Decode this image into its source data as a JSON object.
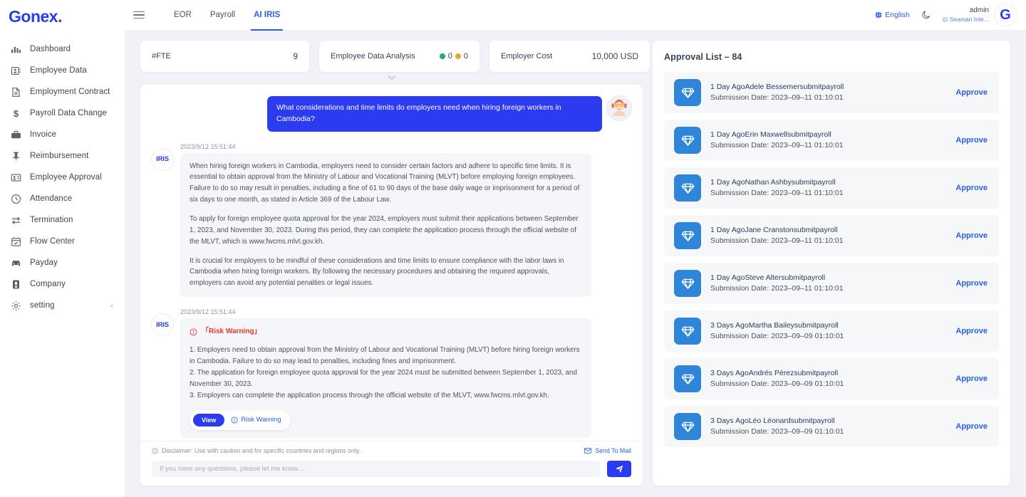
{
  "brand": {
    "logo": "Gonex."
  },
  "sidebar": {
    "items": [
      {
        "label": "Dashboard",
        "icon": "bar-chart-icon"
      },
      {
        "label": "Employee Data",
        "icon": "id-card-icon"
      },
      {
        "label": "Employment Contract",
        "icon": "document-icon"
      },
      {
        "label": "Payroll Data Change",
        "icon": "dollar-icon"
      },
      {
        "label": "Invoice",
        "icon": "briefcase-icon"
      },
      {
        "label": "Reimbursement",
        "icon": "pin-icon"
      },
      {
        "label": "Employee Approval",
        "icon": "badge-icon"
      },
      {
        "label": "Attendance",
        "icon": "clock-icon"
      },
      {
        "label": "Termination",
        "icon": "transfer-icon"
      },
      {
        "label": "Flow Center",
        "icon": "calendar-check-icon"
      },
      {
        "label": "Payday",
        "icon": "car-icon"
      },
      {
        "label": "Company",
        "icon": "building-icon"
      },
      {
        "label": "setting",
        "icon": "gear-icon",
        "chevron": "‹"
      }
    ]
  },
  "topbar": {
    "tabs": [
      {
        "label": "EOR",
        "active": false
      },
      {
        "label": "Payroll",
        "active": false
      },
      {
        "label": "AI IRIS",
        "active": true
      }
    ],
    "language": "English",
    "user_name": "admin",
    "user_org": "Seaman Inte...",
    "avatar_letter": "G"
  },
  "metrics": {
    "fte": {
      "label": "#FTE",
      "value": "9"
    },
    "employee_data_analysis": {
      "label": "Employee Data Analysis",
      "green_count": "0",
      "amber_count": "0"
    },
    "employer_cost": {
      "label": "Employer Cost",
      "value": "10,000 USD"
    }
  },
  "chat": {
    "user_message": "What considerations and time limits do employers need when hiring foreign workers in Cambodia?",
    "ai_name": "IRIS",
    "answer": {
      "time": "2023/9/12 15:51:44",
      "paragraphs": [
        "When hiring foreign workers in Cambodia, employers need to consider certain factors and adhere to specific time limits. It is essential to obtain approval from the Ministry of Labour and Vocational Training (MLVT) before employing foreign employees. Failure to do so may result in penalties, including a fine of 61 to 90 days of the base daily wage or imprisonment for a period of six days to one month, as stated in Article 369 of the Labour Law.",
        "To apply for foreign employee quota approval for the year 2024, employers must submit their applications between September 1, 2023, and November 30, 2023. During this period, they can complete the application process through the official website of the MLVT, which is www.fwcms.mlvt.gov.kh.",
        "It is crucial for employers to be mindful of these considerations and time limits to ensure compliance with the labor laws in Cambodia when hiring foreign workers. By following the necessary procedures and obtaining the required approvals, employers can avoid any potential penalties or legal issues."
      ]
    },
    "risk": {
      "time": "2023/9/12 15:51:44",
      "title": "「Risk Warning」",
      "items": [
        "1. Employers need to obtain approval from the Ministry of Labour and Vocational Training (MLVT) before hiring foreign workers in Cambodia. Failure to do so may lead to penalties, including fines and imprisonment.",
        "2. The application for foreign employee quota approval for the year 2024 must be submitted between September 1, 2023, and November 30, 2023.",
        "3. Employers can complete the application process through the official website of the MLVT, www.fwcms.mlvt.gov.kh."
      ],
      "view_label": "View",
      "link_label": "Risk Warning"
    },
    "disclaimer": "Disclaimer: Use with caution and for specific countries and regions only.",
    "send_to_mail": "Send To Mail",
    "input_placeholder": "If you have any questions, please let me know....",
    "input_value": ""
  },
  "approval": {
    "title": "Approval List – 84",
    "approve_label": "Approve",
    "items": [
      {
        "main": "1 Day AgoAdele Bessemersubmitpayroll",
        "sub": "Submission Date: 2023–09–11 01:10:01"
      },
      {
        "main": "1 Day AgoErin Maxwellsubmitpayroll",
        "sub": "Submission Date: 2023–09–11 01:10:01"
      },
      {
        "main": "1 Day AgoNathan Ashbysubmitpayroll",
        "sub": "Submission Date: 2023–09–11 01:10:01"
      },
      {
        "main": "1 Day AgoJane Cranstonsubmitpayroll",
        "sub": "Submission Date: 2023–09–11 01:10:01"
      },
      {
        "main": "1 Day AgoSteve Altersubmitpayroll",
        "sub": "Submission Date: 2023–09–11 01:10:01"
      },
      {
        "main": "3 Days AgoMartha Baileysubmitpayroll",
        "sub": "Submission Date: 2023–09–09 01:10:01"
      },
      {
        "main": "3 Days AgoAndrés Pérezsubmitpayroll",
        "sub": "Submission Date: 2023–09–09 01:10:01"
      },
      {
        "main": "3 Days AgoLéo Léonardsubmitpayroll",
        "sub": "Submission Date: 2023–09–09 01:10:01"
      }
    ]
  },
  "colors": {
    "brand_blue": "#2b3bf0",
    "link_blue": "#2b5ce6",
    "risk_red": "#e8342b",
    "gem_blue": "#2f86d8",
    "green": "#16b364",
    "amber": "#e8a62d"
  }
}
